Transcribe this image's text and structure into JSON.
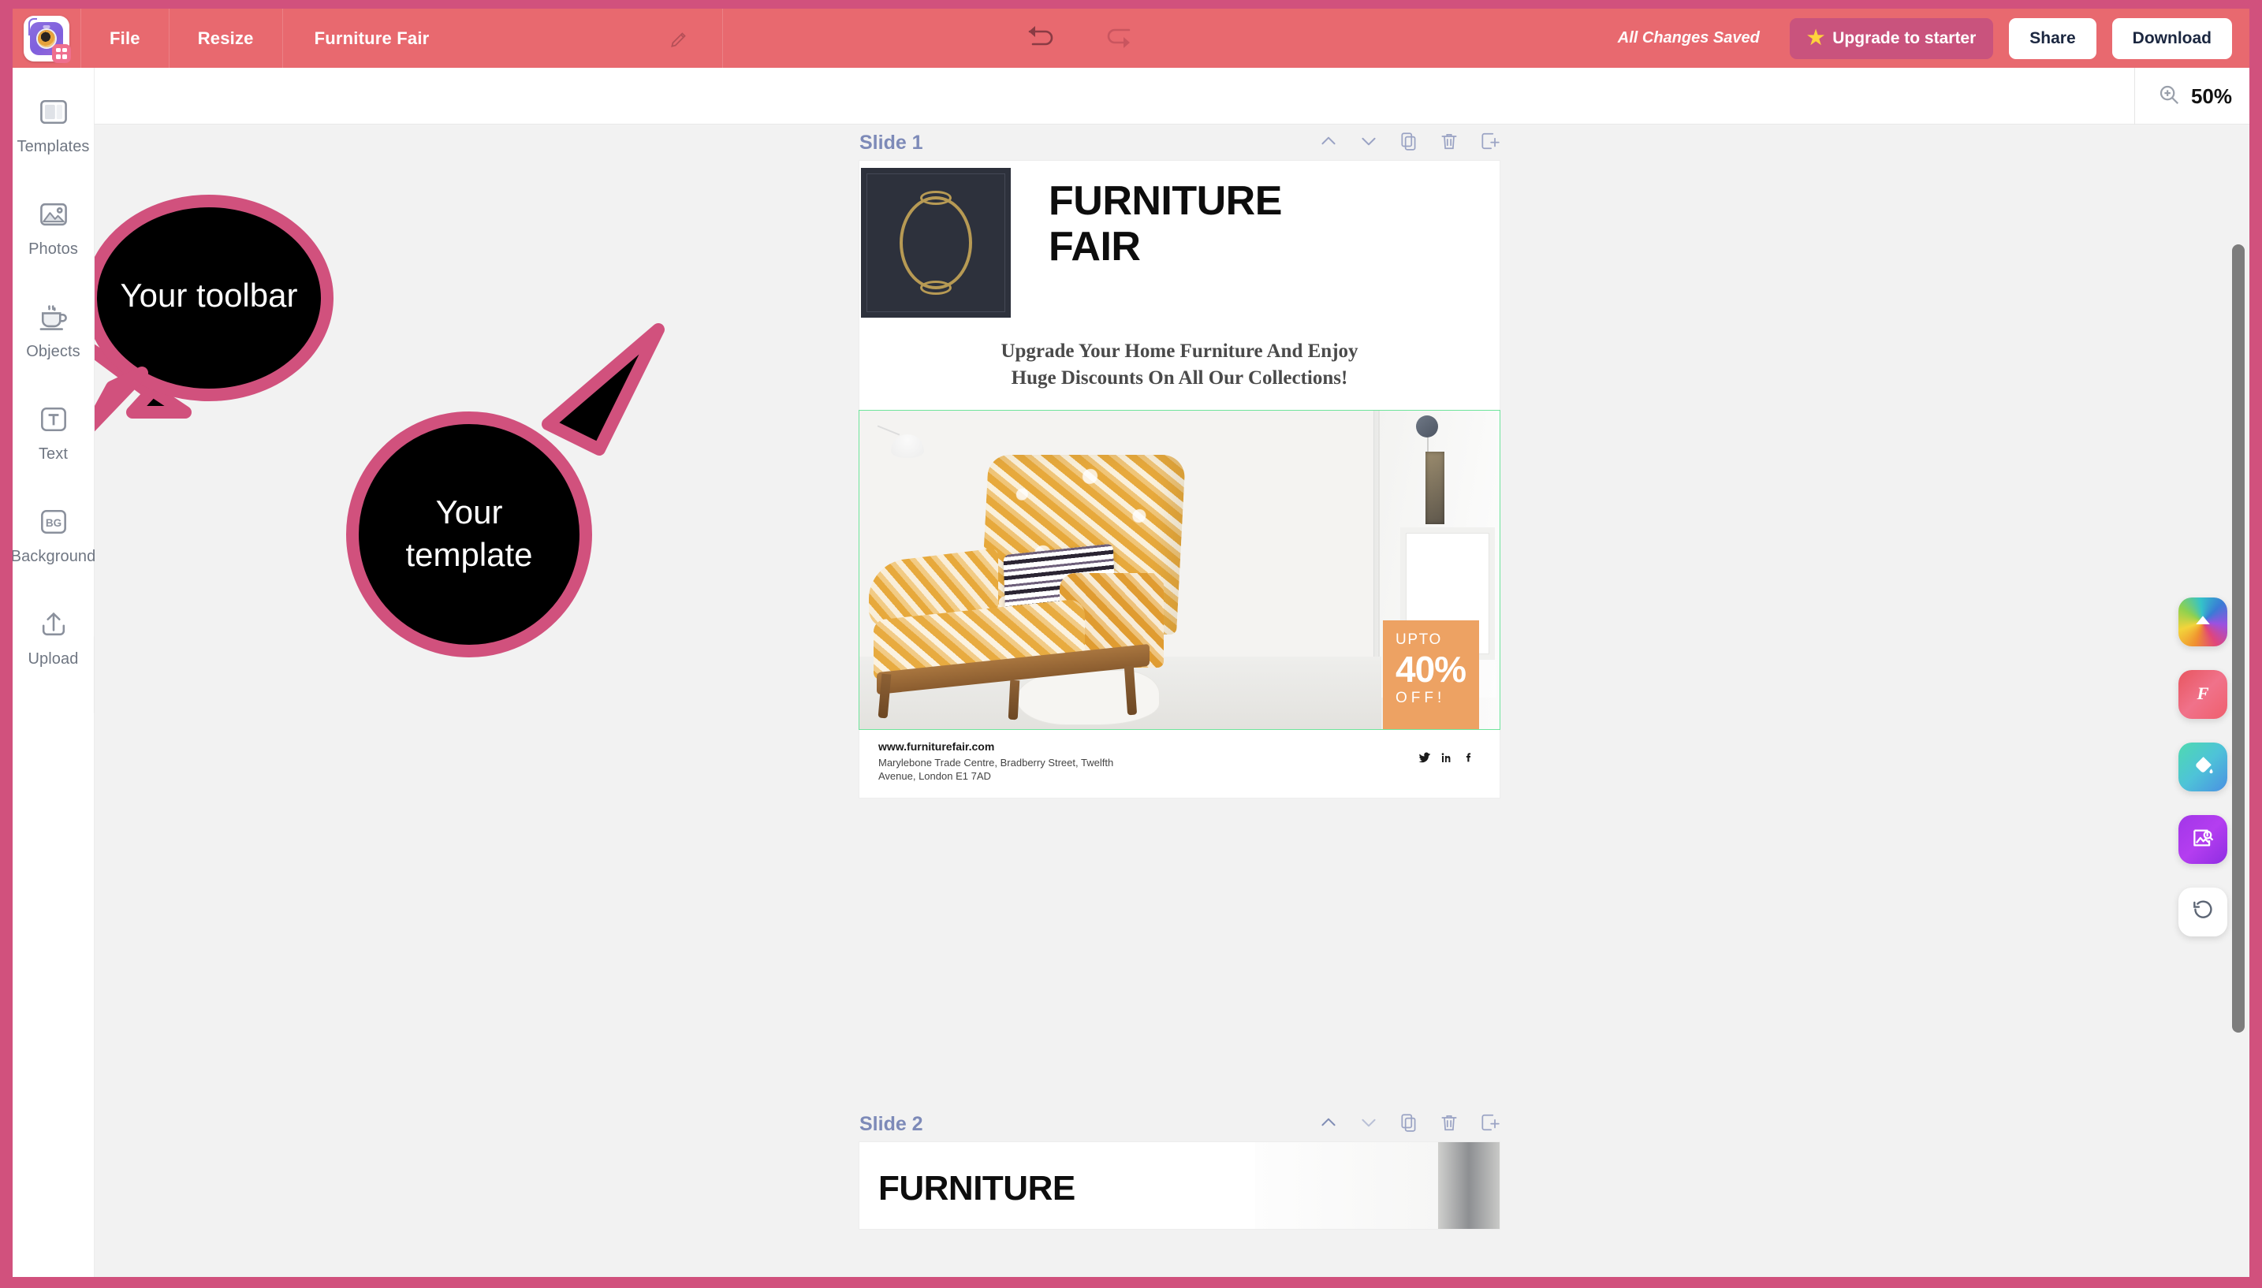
{
  "window": {
    "frame_color": "#d1517d",
    "header_color": "#e8696f"
  },
  "header": {
    "logo_name": "app-logo",
    "menu": [
      {
        "label": "File",
        "name": "menu-file"
      },
      {
        "label": "Resize",
        "name": "menu-resize"
      }
    ],
    "document_title": "Furniture Fair",
    "edit_title_icon": "pencil-icon",
    "undo_icon": "undo-arrow-icon",
    "redo_icon": "redo-arrow-icon",
    "save_status": "All Changes Saved",
    "upgrade_button": "Upgrade to starter",
    "upgrade_icon": "star-icon",
    "share_button": "Share",
    "download_button": "Download"
  },
  "subbar": {
    "zoom_icon": "zoom-in-magnifier-icon",
    "zoom_level": "50%"
  },
  "sidebar": {
    "items": [
      {
        "label": "Templates",
        "icon": "template-layout-icon",
        "name": "sidebar-item-templates"
      },
      {
        "label": "Photos",
        "icon": "image-mountain-icon",
        "name": "sidebar-item-photos"
      },
      {
        "label": "Objects",
        "icon": "coffee-cup-icon",
        "name": "sidebar-item-objects"
      },
      {
        "label": "Text",
        "icon": "text-t-icon",
        "name": "sidebar-item-text"
      },
      {
        "label": "Background",
        "icon": "bg-square-icon",
        "name": "sidebar-item-background"
      },
      {
        "label": "Upload",
        "icon": "upload-arrow-icon",
        "name": "sidebar-item-upload"
      }
    ],
    "collapse_icon": "chevron-right-icon"
  },
  "callouts": [
    {
      "text": "Your toolbar",
      "name": "callout-your-toolbar",
      "fill": "#000000",
      "stroke": "#d1517d"
    },
    {
      "text": "Your\ntemplate",
      "line1": "Your",
      "line2": "template",
      "name": "callout-your-template",
      "fill": "#000000",
      "stroke": "#d1517d"
    }
  ],
  "slides": [
    {
      "title": "Slide 1",
      "tools": [
        {
          "icon": "chevron-up-icon",
          "name": "slide-move-up-button"
        },
        {
          "icon": "chevron-down-icon",
          "name": "slide-move-down-button"
        },
        {
          "icon": "duplicate-icon",
          "name": "slide-duplicate-button"
        },
        {
          "icon": "trash-icon",
          "name": "slide-delete-button"
        },
        {
          "icon": "add-slide-icon",
          "name": "slide-add-button"
        }
      ],
      "design": {
        "logo_label": "ornate-oval-frame-logo",
        "heading_line1": "FURNITURE",
        "heading_line2": "FAIR",
        "subheading_line1": "Upgrade Your Home Furniture And Enjoy",
        "subheading_line2": "Huge Discounts On All Our Collections!",
        "photo_alt": "orange-patterned-armchair-photo",
        "selection_color": "#6ee49b",
        "badge": {
          "color": "#eda263",
          "line1": "UPTO",
          "line2": "40%",
          "line3": "OFF!"
        },
        "footer": {
          "website": "www.furniturefair.com",
          "address_line1": "Marylebone Trade Centre, Bradberry Street, Twelfth",
          "address_line2": "Avenue, London E1 7AD",
          "socials": [
            {
              "icon": "twitter-icon",
              "name": "social-twitter"
            },
            {
              "icon": "linkedin-icon",
              "name": "social-linkedin"
            },
            {
              "icon": "facebook-icon",
              "name": "social-facebook"
            }
          ]
        }
      }
    },
    {
      "title": "Slide 2",
      "tools": [
        {
          "icon": "chevron-up-icon",
          "name": "slide-move-up-button"
        },
        {
          "icon": "chevron-down-icon",
          "name": "slide-move-down-button"
        },
        {
          "icon": "duplicate-icon",
          "name": "slide-duplicate-button"
        },
        {
          "icon": "trash-icon",
          "name": "slide-delete-button"
        },
        {
          "icon": "add-slide-icon",
          "name": "slide-add-button"
        }
      ],
      "design": {
        "heading_partial": "FURNITURE"
      }
    }
  ],
  "right_toolbar": [
    {
      "icon": "color-palette-icon",
      "name": "tool-colors"
    },
    {
      "icon": "font-f-icon",
      "name": "tool-fonts"
    },
    {
      "icon": "paint-bucket-icon",
      "name": "tool-fill"
    },
    {
      "icon": "image-search-icon",
      "name": "tool-image-search"
    },
    {
      "icon": "history-undo-icon",
      "name": "tool-version-history"
    }
  ]
}
